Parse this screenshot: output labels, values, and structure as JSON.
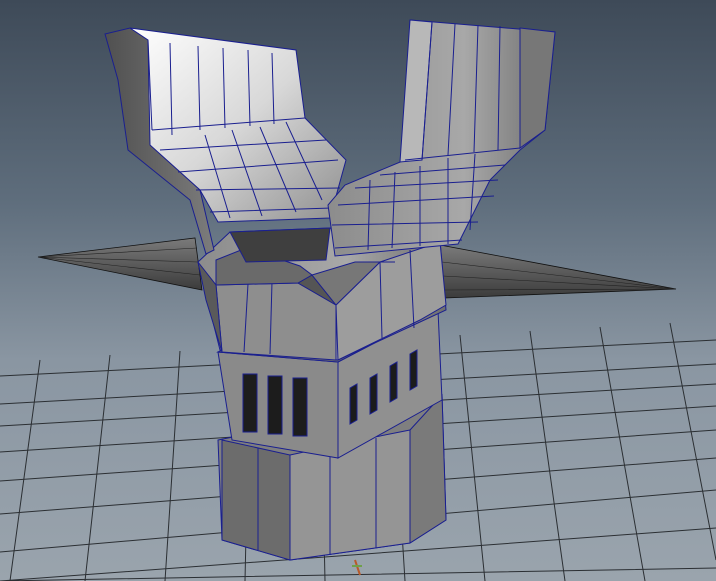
{
  "viewport": {
    "background_top": "#3e4a58",
    "background_bottom": "#9aa4ad",
    "grid_color": "#2b2f33",
    "wireframe_color": "#1a1f8f",
    "scene_object": "robot-head-polygon-mesh"
  }
}
